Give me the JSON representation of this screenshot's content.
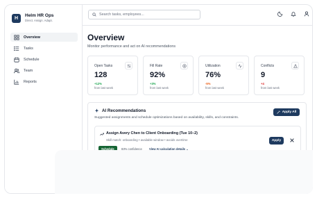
{
  "app": {
    "title": "Helm HR Ops",
    "subtitle": "Direct. Assign. Adapt.",
    "logo_letter": "H"
  },
  "nav": {
    "items": [
      {
        "label": "Overview",
        "icon": "grid-icon",
        "active": true
      },
      {
        "label": "Tasks",
        "icon": "list-icon",
        "active": false
      },
      {
        "label": "Schedule",
        "icon": "calendar-icon",
        "active": false
      },
      {
        "label": "Team",
        "icon": "users-icon",
        "active": false
      },
      {
        "label": "Reports",
        "icon": "chart-icon",
        "active": false
      }
    ]
  },
  "search": {
    "placeholder": "Search tasks, employees..."
  },
  "topbar": {
    "icons": [
      "moon-icon",
      "bell-icon",
      "user-icon"
    ]
  },
  "page": {
    "title": "Overview",
    "subtitle": "Monitor performance and act on AI recommendations"
  },
  "metrics": [
    {
      "label": "Open Tasks",
      "value": "128",
      "delta": "+12%",
      "from": "from last week",
      "delta_color": "#16a34a",
      "icon": "sliders-icon"
    },
    {
      "label": "Fill Rate",
      "value": "92%",
      "delta": "+3%",
      "from": "from last week",
      "delta_color": "#16a34a",
      "icon": "target-icon"
    },
    {
      "label": "Utilization",
      "value": "76%",
      "delta": "-5%",
      "from": "from last week",
      "delta_color": "#ea580c",
      "icon": "pulse-icon"
    },
    {
      "label": "Conflicts",
      "value": "9",
      "delta": "+4",
      "from": "from last week",
      "delta_color": "#dc2626",
      "icon": "warning-icon"
    }
  ],
  "ai": {
    "title": "AI Recommendations",
    "description": "Suggested assignments and schedule optimizations based on availability, skills, and constraints.",
    "apply_all_label": "Apply All",
    "recommendations": [
      {
        "title": "Assign Avery Chen to Client Onboarding (Tue 10–2)",
        "description": "Skill match: onboarding • available window • avoids overtime",
        "tag": "Schedule",
        "confidence": "83% confidence",
        "link": "View AI calculation details ⌄",
        "apply_label": "Apply"
      }
    ]
  },
  "colors": {
    "accent": "#1e3a5f",
    "tag": "#166534"
  }
}
